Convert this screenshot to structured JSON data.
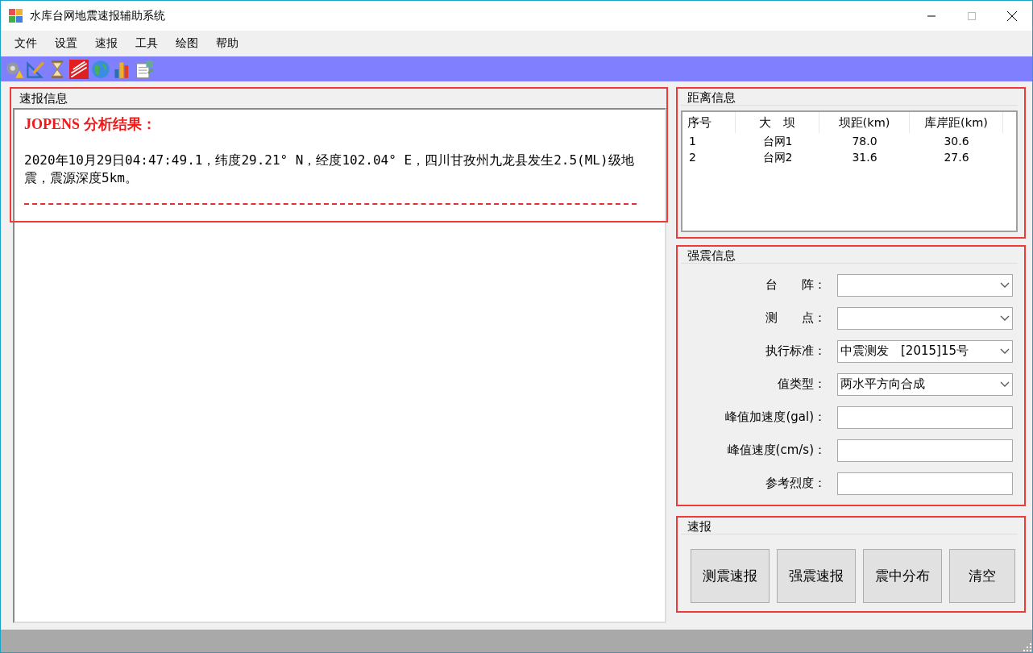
{
  "window": {
    "title": "水库台网地震速报辅助系统"
  },
  "menu": [
    "文件",
    "设置",
    "速报",
    "工具",
    "绘图",
    "帮助"
  ],
  "report": {
    "title": "速报信息",
    "heading": "JOPENS 分析结果：",
    "body": "2020年10月29日04:47:49.1，纬度29.21° N，经度102.04° E，四川甘孜州九龙县发生2.5(ML)级地震，震源深度5km。"
  },
  "distance": {
    "title": "距离信息",
    "columns": [
      "序号",
      "大　坝",
      "坝距(km)",
      "库岸距(km)"
    ],
    "rows": [
      [
        "1",
        "台网1",
        "78.0",
        "30.6"
      ],
      [
        "2",
        "台网2",
        "31.6",
        "27.6"
      ]
    ]
  },
  "strong_motion": {
    "title": "强震信息",
    "fields": [
      {
        "kind": "dropdown",
        "label": "台　　阵："
      },
      {
        "kind": "dropdown",
        "label": "测　　点："
      },
      {
        "kind": "dropdown",
        "label": "执行标准：",
        "value": "中震测发　[2015]15号"
      },
      {
        "kind": "dropdown",
        "label": "值类型：",
        "value": "两水平方向合成"
      },
      {
        "kind": "text",
        "label": "峰值加速度(gal)："
      },
      {
        "kind": "text",
        "label": "峰值速度(cm/s)："
      },
      {
        "kind": "text",
        "label": "参考烈度："
      }
    ]
  },
  "quick_report": {
    "title": "速报",
    "buttons": [
      "测震速报",
      "强震速报",
      "震中分布",
      "清空"
    ]
  }
}
